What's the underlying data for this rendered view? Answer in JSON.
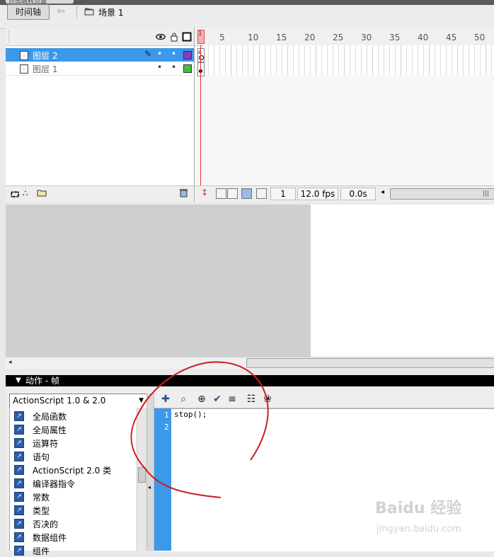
{
  "window": {
    "tab_title": "点击跳转页面"
  },
  "timeline_toolbar": {
    "timeline_tab": "时间轴",
    "scene_label": "场景 1"
  },
  "layers": [
    {
      "name": "图层 2",
      "selected": true,
      "color": "#8040c0"
    },
    {
      "name": "图层 1",
      "selected": false,
      "color": "#40c040"
    }
  ],
  "ruler": {
    "ticks": [
      "1",
      "5",
      "10",
      "15",
      "20",
      "25",
      "30",
      "35",
      "40",
      "45",
      "50"
    ]
  },
  "timeline_footer": {
    "current_frame": "1",
    "fps": "12.0 fps",
    "time": "0.0s"
  },
  "actions_panel": {
    "header": "动作 - 帧",
    "script_version": "ActionScript 1.0 & 2.0",
    "categories": [
      "全局函数",
      "全局属性",
      "运算符",
      "语句",
      "ActionScript 2.0 类",
      "编译器指令",
      "常数",
      "类型",
      "否决的",
      "数据组件",
      "组件"
    ],
    "lines": [
      {
        "num": "1",
        "code": "stop();"
      },
      {
        "num": "2",
        "code": ""
      }
    ]
  },
  "watermark": {
    "brand": "Baidu 经验",
    "site": "jingyan.baidu.com"
  }
}
